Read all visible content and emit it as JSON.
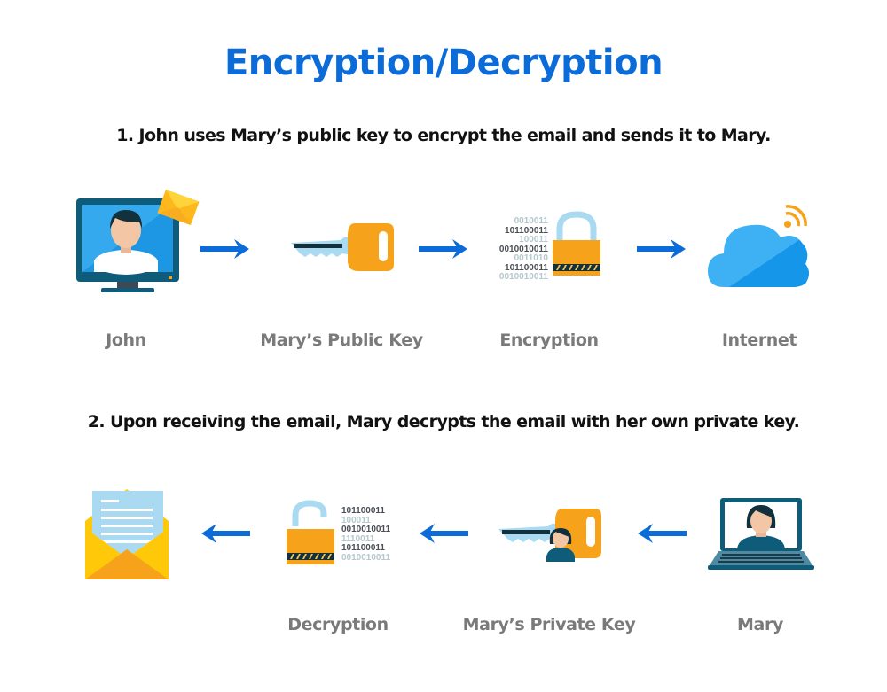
{
  "title": "Encryption/Decryption",
  "colors": {
    "title": "#0b6bd9",
    "arrow": "#0b6bd9",
    "label": "#7a7a7a",
    "step_text": "#111111",
    "key_orange": "#f7a21b",
    "monitor_frame": "#0e5b7a",
    "cloud_light": "#3eb1f5",
    "cloud_dark": "#1596e8",
    "envelope_yellow": "#ffc90a"
  },
  "steps": [
    {
      "text": "1. John uses Mary’s public key to encrypt the email and sends it to Mary.",
      "flow_direction": "left-to-right",
      "nodes": [
        {
          "label": "John",
          "icon": "monitor-with-user-and-envelope-icon"
        },
        {
          "label": "Mary’s Public Key",
          "icon": "key-icon"
        },
        {
          "label": "Encryption",
          "icon": "locked-padlock-binary-icon"
        },
        {
          "label": "Internet",
          "icon": "cloud-wifi-icon"
        }
      ],
      "binary": [
        "0010011",
        "101100011",
        "100011",
        "0010010011",
        "0011010",
        "101100011",
        "0010010011"
      ]
    },
    {
      "text": "2. Upon receiving the email, Mary decrypts the email with her own private key.",
      "flow_direction": "right-to-left",
      "nodes": [
        {
          "label": "",
          "icon": "open-envelope-letter-icon"
        },
        {
          "label": "Decryption",
          "icon": "unlocked-padlock-binary-icon"
        },
        {
          "label": "Mary’s Private Key",
          "icon": "key-with-user-icon"
        },
        {
          "label": "Mary",
          "icon": "laptop-with-user-icon"
        }
      ],
      "binary": [
        "101100011",
        "100011",
        "0010010011",
        "1110011",
        "101100011",
        "0010010011"
      ]
    }
  ]
}
